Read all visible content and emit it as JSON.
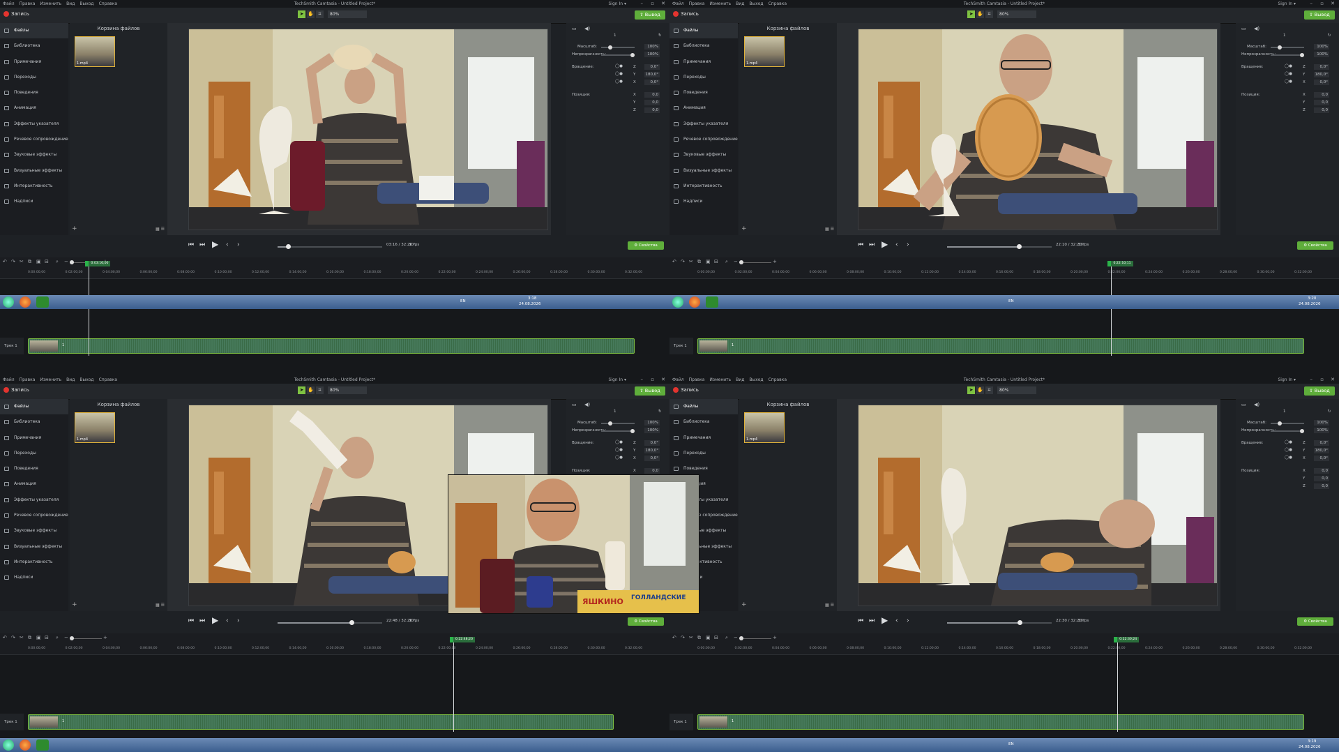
{
  "app": {
    "window_title": "TechSmith Camtasia - Untitled Project*",
    "menus": [
      "Файл",
      "Правка",
      "Изменить",
      "Вид",
      "Выход",
      "Справка"
    ],
    "sign_in": "Sign In ▾",
    "record_label": "Запись",
    "zoom": "80%",
    "export_label": "Вывод",
    "bin_title": "Корзина файлов",
    "media_name": "1.mp4",
    "properties_button": "Свойства",
    "fps": "30fps",
    "track_name": "Трек 1",
    "clip_label": "1",
    "sidebar": [
      "Файлы",
      "Библиотека",
      "Примечания",
      "Переходы",
      "Поведения",
      "Анимация",
      "Эффекты указателя",
      "Речевое сопровождение",
      "Звуковые эффекты",
      "Визуальные эффекты",
      "Интерактивность",
      "Надписи"
    ],
    "properties": {
      "clip_name": "1",
      "scale_label": "Масштаб:",
      "scale_value": "100%",
      "scale_fraction": 0.2,
      "opacity_label": "Непрозрачность:",
      "opacity_value": "100%",
      "opacity_fraction": 1.0,
      "rotation_label": "Вращение:",
      "rotation": {
        "z": "0,0°",
        "y": "180,0°",
        "x": "0,0°"
      },
      "position_label": "Позиция:",
      "position": {
        "x": "0,0",
        "y": "0,0",
        "z": "0,0"
      },
      "axis_labels": [
        "Z",
        "Y",
        "X"
      ],
      "position_axes": [
        "X",
        "Y",
        "Z"
      ]
    },
    "ruler_ticks": [
      "0:00:00;00",
      "0:02:00;00",
      "0:04:00;00",
      "0:06:00;00",
      "0:08:00;00",
      "0:10:00;00",
      "0:12:00;00",
      "0:14:00;00",
      "0:16:00;00",
      "0:18:00;00",
      "0:20:00;00",
      "0:22:00;00",
      "0:24:00;00",
      "0:26:00;00",
      "0:28:00;00",
      "0:30:00;00",
      "0:32:00;00"
    ]
  },
  "taskbar": {
    "lang": "EN",
    "date": "24.08.2026",
    "times": [
      "3:18",
      "3:20",
      "3:19"
    ]
  },
  "quadrants": [
    {
      "player_time": "03:16 / 32:20",
      "playhead_label": "0:03:16;00",
      "progress": 0.101,
      "scene": "lift"
    },
    {
      "player_time": "22:10 / 32:20",
      "playhead_label": "0:22:10;11",
      "progress": 0.686,
      "scene": "wafer"
    },
    {
      "player_time": "22:48 / 32:20",
      "playhead_label": "0:22:48;20",
      "progress": 0.705,
      "scene": "drink"
    },
    {
      "player_time": "22:30 / 32:20",
      "playhead_label": "0:22:30;24",
      "progress": 0.696,
      "scene": "lean"
    }
  ],
  "overlay": {
    "brand_text": "ЯШКИНО",
    "product_text": "ГОЛЛАНДСКИЕ"
  }
}
